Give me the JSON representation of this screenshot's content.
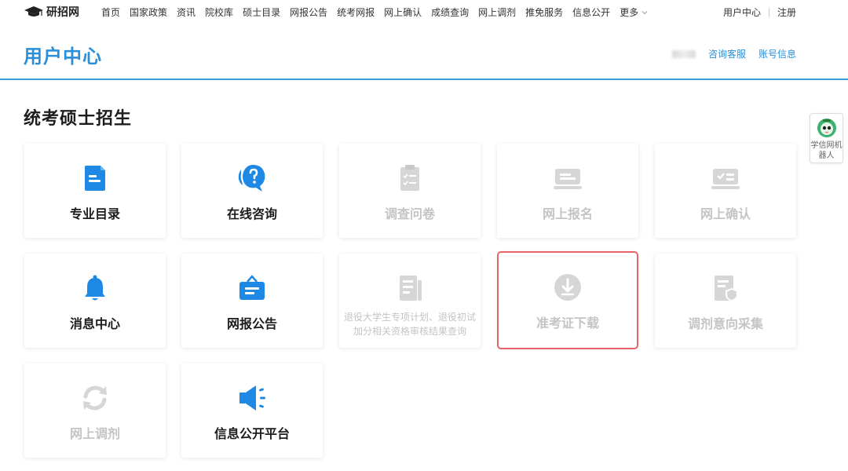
{
  "topnav": {
    "logo_text": "研招网",
    "items": [
      "首页",
      "国家政策",
      "资讯",
      "院校库",
      "硕士目录",
      "网报公告",
      "统考网报",
      "网上确认",
      "成绩查询",
      "网上调剂",
      "推免服务",
      "信息公开"
    ],
    "more_label": "更多",
    "user_center": "用户中心",
    "register": "注册"
  },
  "header": {
    "title": "用户中心",
    "links": [
      "咨询客服",
      "账号信息"
    ]
  },
  "section": {
    "title": "统考硕士招生"
  },
  "cards": [
    {
      "label": "专业目录",
      "icon": "document-icon",
      "enabled": true
    },
    {
      "label": "在线咨询",
      "icon": "question-chat-icon",
      "enabled": true
    },
    {
      "label": "调查问卷",
      "icon": "clipboard-icon",
      "enabled": false
    },
    {
      "label": "网上报名",
      "icon": "laptop-icon",
      "enabled": false
    },
    {
      "label": "网上确认",
      "icon": "laptop-check-icon",
      "enabled": false
    },
    {
      "label": "消息中心",
      "icon": "bell-icon",
      "enabled": true
    },
    {
      "label": "网报公告",
      "icon": "notice-board-icon",
      "enabled": true
    },
    {
      "label": "退役大学生专项计划、退役初试加分相关资格审核结果查询",
      "icon": "report-icon",
      "enabled": false
    },
    {
      "label": "准考证下载",
      "icon": "download-icon",
      "enabled": false,
      "highlighted": true
    },
    {
      "label": "调剂意向采集",
      "icon": "doc-shield-icon",
      "enabled": false
    },
    {
      "label": "网上调剂",
      "icon": "refresh-icon",
      "enabled": false
    },
    {
      "label": "信息公开平台",
      "icon": "speaker-icon",
      "enabled": true
    }
  ],
  "robot": {
    "label": "学信网机器人"
  },
  "colors": {
    "accent": "#2a8fd8",
    "icon_active": "#1e88e5",
    "icon_disabled": "#d6d6d6",
    "highlight": "#e9656a"
  }
}
